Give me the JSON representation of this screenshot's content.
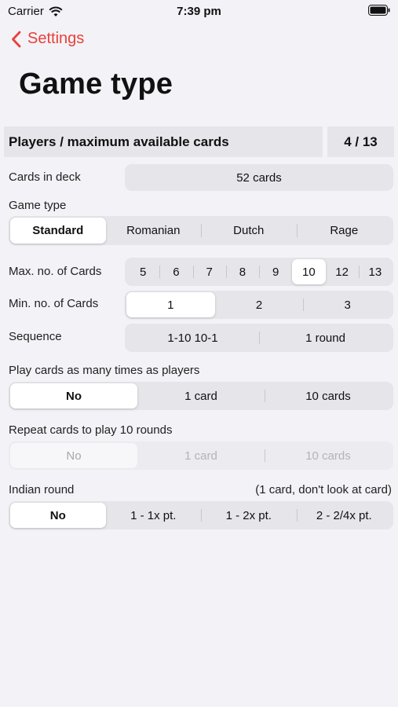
{
  "status": {
    "carrier": "Carrier",
    "time": "7:39 pm"
  },
  "nav": {
    "back_label": "Settings",
    "title": "Game type"
  },
  "header": {
    "label": "Players / maximum available cards",
    "value": "4 / 13"
  },
  "deck": {
    "label": "Cards in deck",
    "value": "52 cards"
  },
  "game_type": {
    "label": "Game type",
    "options": [
      "Standard",
      "Romanian",
      "Dutch",
      "Rage"
    ],
    "selected": "Standard"
  },
  "max_cards": {
    "label": "Max. no. of Cards",
    "options": [
      "5",
      "6",
      "7",
      "8",
      "9",
      "10",
      "12",
      "13"
    ],
    "selected": "10"
  },
  "min_cards": {
    "label": "Min. no. of Cards",
    "options": [
      "1",
      "2",
      "3"
    ],
    "selected": "1"
  },
  "sequence": {
    "label": "Sequence",
    "options": [
      "1-10 10-1",
      "1 round"
    ]
  },
  "play_as_players": {
    "label": "Play cards as many times as players",
    "options": [
      "No",
      "1 card",
      "10 cards"
    ],
    "selected": "No"
  },
  "repeat_cards": {
    "label": "Repeat cards to play 10 rounds",
    "options": [
      "No",
      "1 card",
      "10 cards"
    ],
    "selected": "No",
    "disabled": true
  },
  "indian_round": {
    "label": "Indian round",
    "note": "(1 card, don't look at card)",
    "options": [
      "No",
      "1 - 1x pt.",
      "1 - 2x pt.",
      "2 - 2/4x pt."
    ],
    "selected": "No"
  },
  "colors": {
    "accent": "#e8413a",
    "background": "#f2f2f7",
    "control": "#e5e5ea",
    "selected": "#ffffff"
  }
}
